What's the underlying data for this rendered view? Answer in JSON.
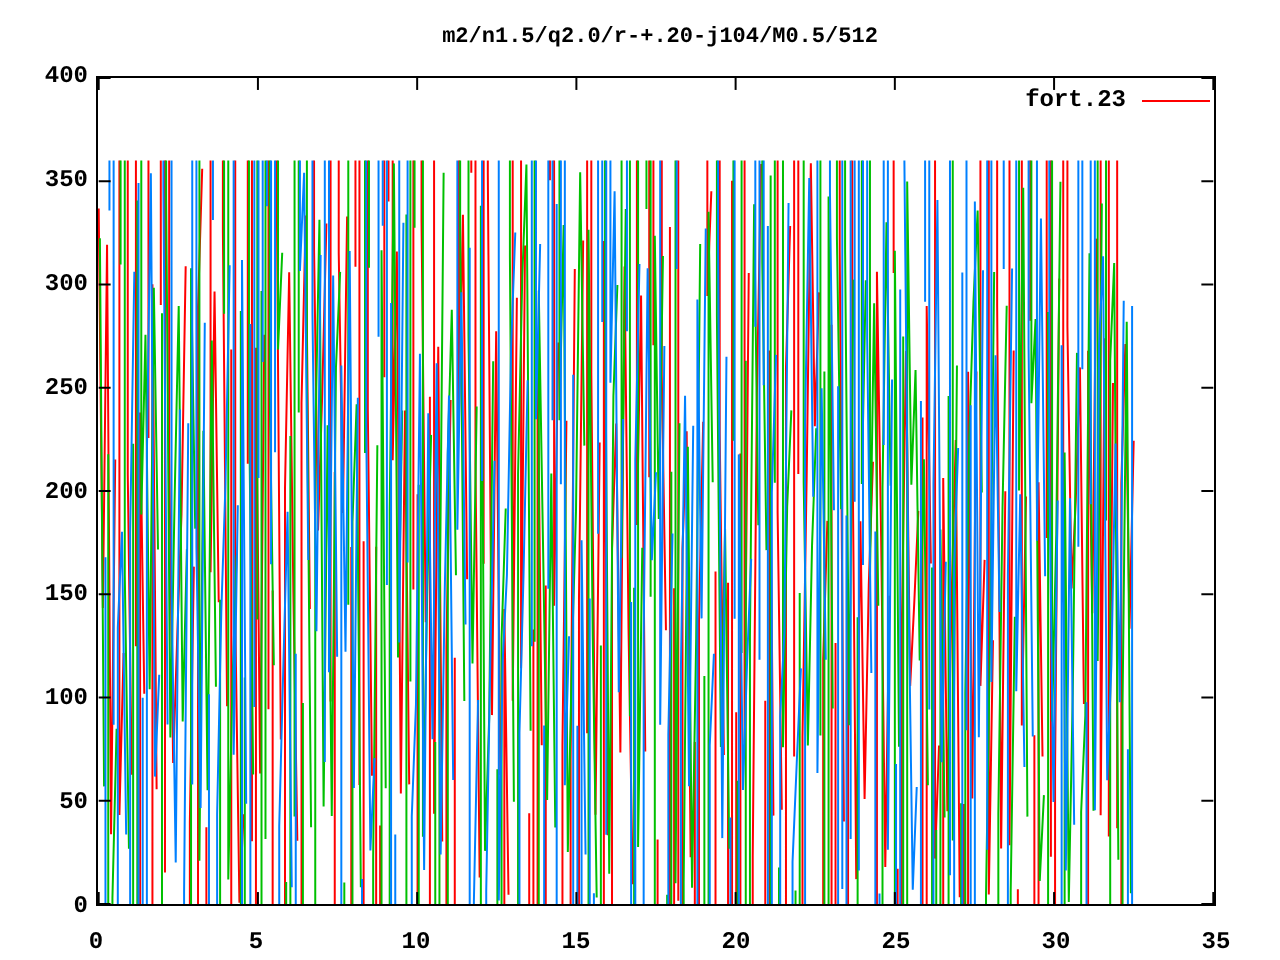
{
  "plot": {
    "title": "m2/n1.5/q2.0/r-+.20-j104/M0.5/512",
    "y_ticks": [
      "400",
      "350",
      "300",
      "250",
      "200",
      "150",
      "100",
      "50",
      "0"
    ],
    "x_ticks": [
      "0",
      "5",
      "10",
      "15",
      "20",
      "25",
      "30",
      "35"
    ],
    "legend": {
      "label": "fort.23"
    }
  }
}
